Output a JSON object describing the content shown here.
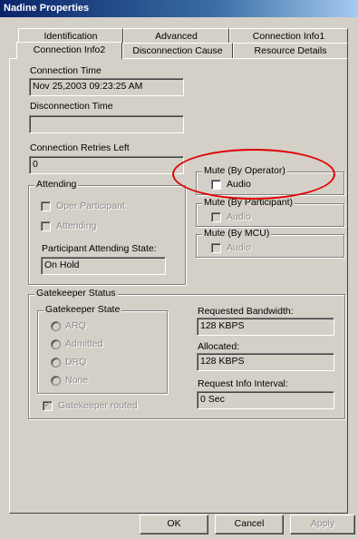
{
  "window": {
    "title": "Nadine Properties"
  },
  "tabs": {
    "row1": [
      "Identification",
      "Advanced",
      "Connection Info1"
    ],
    "row2": [
      "Connection Info2",
      "Disconnection Cause",
      "Resource Details"
    ],
    "active": "Connection Info2"
  },
  "connection": {
    "time_label": "Connection Time",
    "time_value": "Nov 25,2003  09:23:25 AM",
    "disconnection_label": "Disconnection Time",
    "disconnection_value": "",
    "retries_label": "Connection Retries Left",
    "retries_value": "0"
  },
  "attending": {
    "group_title": "Attending",
    "oper_participant": "Oper Participant",
    "attending": "Attending",
    "state_label": "Participant Attending State:",
    "state_value": "On Hold"
  },
  "mute": {
    "operator_title": "Mute (By Operator)",
    "operator_audio": "Audio",
    "participant_title": "Mute (By Participant)",
    "participant_audio": "Audio",
    "mcu_title": "Mute (By MCU)",
    "mcu_audio": "Audio"
  },
  "gatekeeper": {
    "group_title": "Gatekeeper Status",
    "state_title": "Gatekeeper State",
    "options": [
      "ARQ",
      "Admitted",
      "DRQ",
      "None"
    ],
    "routed": "Gatekeeper routed",
    "requested_label": "Requested Bandwidth:",
    "requested_value": "128  KBPS",
    "allocated_label": "Allocated:",
    "allocated_value": "128  KBPS",
    "interval_label": "Request Info Interval:",
    "interval_value": "0  Sec"
  },
  "buttons": {
    "ok": "OK",
    "cancel": "Cancel",
    "apply": "Apply"
  },
  "annotation_color": "#e00000"
}
